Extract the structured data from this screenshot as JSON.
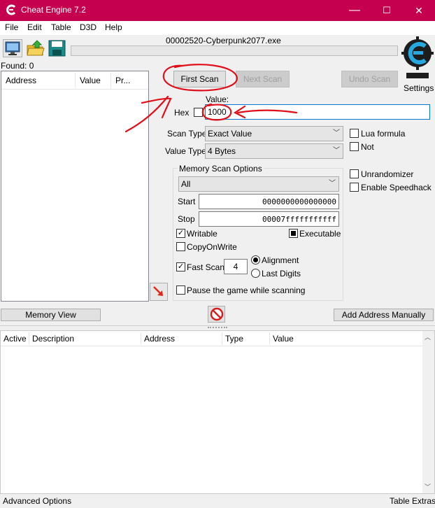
{
  "window": {
    "title": "Cheat Engine 7.2",
    "minimize": "—",
    "maximize": "☐",
    "close": "✕"
  },
  "menu": [
    "File",
    "Edit",
    "Table",
    "D3D",
    "Help"
  ],
  "process_name": "00002520-Cyberpunk2077.exe",
  "found_label": "Found: 0",
  "settings_label": "Settings",
  "results_columns": [
    "Address",
    "Value",
    "Pr..."
  ],
  "buttons": {
    "first_scan": "First Scan",
    "next_scan": "Next Scan",
    "undo_scan": "Undo Scan",
    "memory_view": "Memory View",
    "add_address": "Add Address Manually"
  },
  "value_section": {
    "label": "Value:",
    "hex_label": "Hex",
    "value": "1000"
  },
  "scan_type": {
    "label": "Scan Type",
    "selected": "Exact Value"
  },
  "value_type": {
    "label": "Value Type",
    "selected": "4 Bytes"
  },
  "options": {
    "lua_formula": "Lua formula",
    "not": "Not",
    "unrandomizer": "Unrandomizer",
    "speedhack": "Enable Speedhack"
  },
  "memory_scan": {
    "title": "Memory Scan Options",
    "region": "All",
    "start_label": "Start",
    "start_value": "0000000000000000",
    "stop_label": "Stop",
    "stop_value": "00007fffffffffff",
    "writable": "Writable",
    "executable": "Executable",
    "copy_on_write": "CopyOnWrite",
    "fast_scan": "Fast Scan",
    "fast_scan_value": "4",
    "alignment": "Alignment",
    "last_digits": "Last Digits",
    "pause_game": "Pause the game while scanning"
  },
  "address_columns": [
    "Active",
    "Description",
    "Address",
    "Type",
    "Value"
  ],
  "footer": {
    "advanced": "Advanced Options",
    "extras": "Table Extras"
  },
  "colors": {
    "titlebar": "#c4004f",
    "annotation": "#e0101a"
  },
  "icons": [
    "cheat-engine-icon",
    "computer-icon",
    "open-folder-icon",
    "save-icon",
    "cheat-engine-logo",
    "arrow-icon",
    "stop-icon"
  ]
}
